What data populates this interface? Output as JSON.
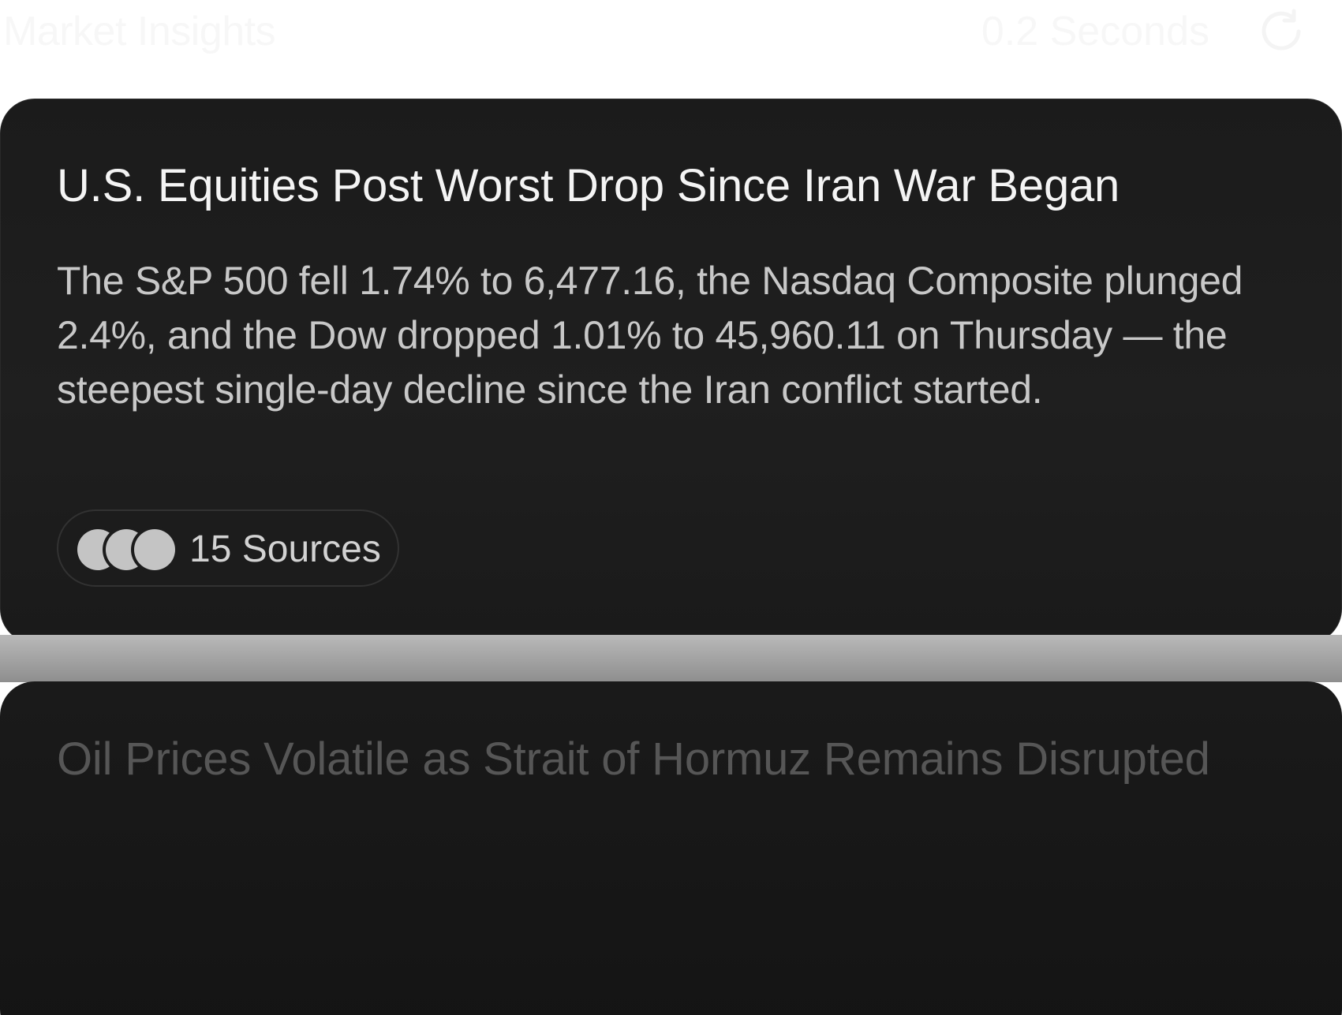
{
  "header": {
    "title": "Market Insights",
    "timer": "0.2 Seconds",
    "refresh_icon": "refresh-icon"
  },
  "cards": [
    {
      "title": "U.S. Equities Post Worst Drop Since Iran War Began",
      "summary": "The S&P 500 fell 1.74% to 6,477.16, the Nasdaq Composite plunged 2.4%, and the Dow dropped 1.01% to 45,960.11 on Thursday — the steepest single-day decline since the Iran conflict started.",
      "sources_label": "15 Sources",
      "source_icons": [
        "source-avatar-icon",
        "source-avatar-icon",
        "source-avatar-icon"
      ]
    },
    {
      "title": "Oil Prices Volatile as Strait of Hormuz Remains Disrupted"
    }
  ],
  "colors": {
    "card_background": "#1c1c1c",
    "title_text": "#f4f4f4",
    "body_text": "#c8c8c8",
    "faded_title": "#565656"
  }
}
